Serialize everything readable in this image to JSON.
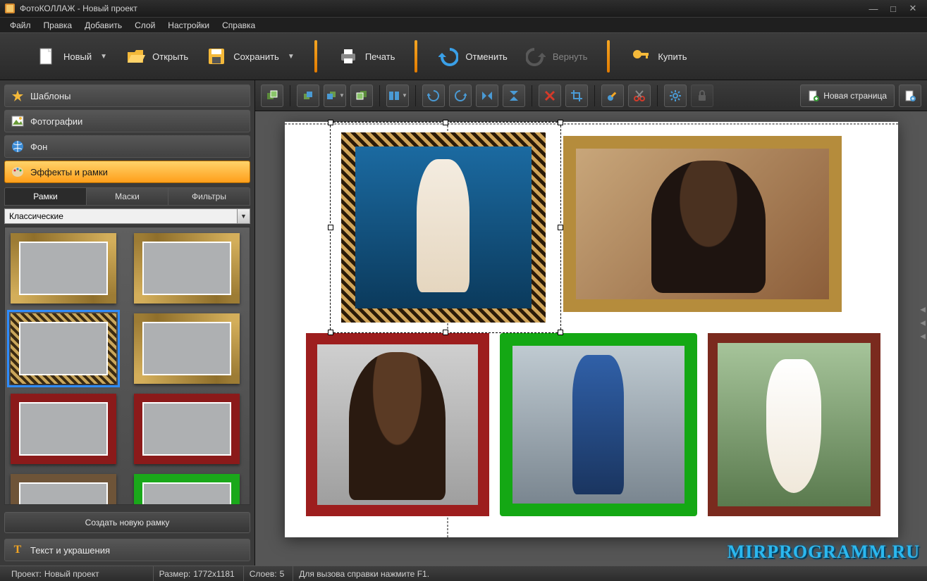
{
  "title": "ФотоКОЛЛАЖ - Новый проект",
  "menu": {
    "file": "Файл",
    "edit": "Правка",
    "add": "Добавить",
    "layer": "Слой",
    "settings": "Настройки",
    "help": "Справка"
  },
  "toolbar": {
    "new": "Новый",
    "open": "Открыть",
    "save": "Сохранить",
    "print": "Печать",
    "undo": "Отменить",
    "redo": "Вернуть",
    "buy": "Купить"
  },
  "accordion": {
    "templates": "Шаблоны",
    "photos": "Фотографии",
    "background": "Фон",
    "effects": "Эффекты и рамки",
    "text": "Текст и украшения"
  },
  "subtabs": {
    "frames": "Рамки",
    "masks": "Маски",
    "filters": "Фильтры"
  },
  "combo": {
    "selected": "Классические"
  },
  "create_frame": "Создать новую рамку",
  "canvas_toolbar": {
    "new_page": "Новая страница"
  },
  "status": {
    "project_label": "Проект:",
    "project_name": "Новый проект",
    "size_label": "Размер:",
    "size_value": "1772x1181",
    "layers_label": "Слоев:",
    "layers_value": "5",
    "help": "Для вызова справки нажмите F1."
  },
  "watermark": "MIRPROGRAMM.RU",
  "colors": {
    "accent": "#ff9f1a"
  }
}
